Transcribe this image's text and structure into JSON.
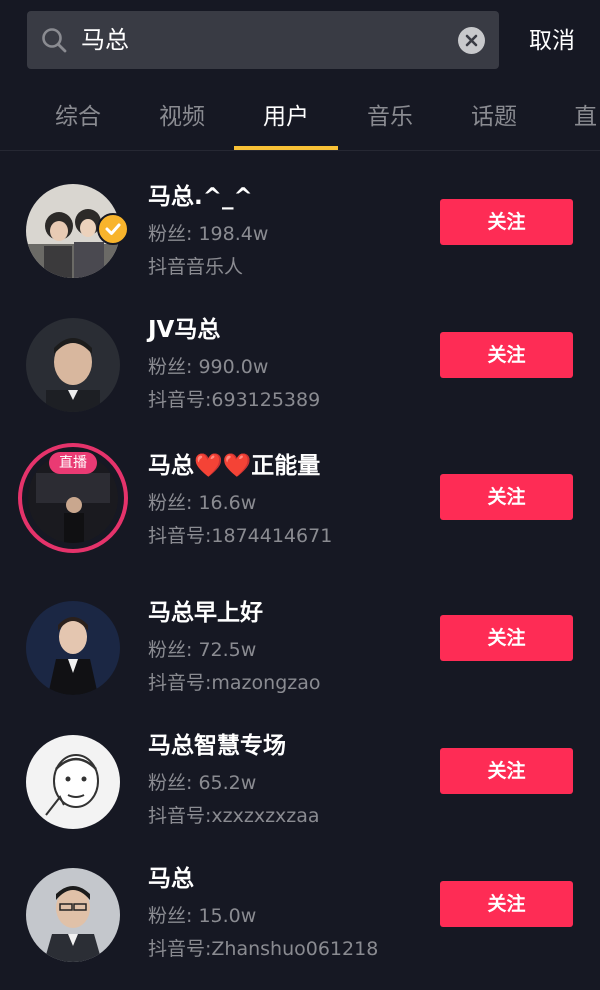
{
  "search": {
    "query": "马总",
    "cancel_label": "取消"
  },
  "tabs": [
    {
      "label": "综合"
    },
    {
      "label": "视频"
    },
    {
      "label": "用户"
    },
    {
      "label": "音乐"
    },
    {
      "label": "话题"
    },
    {
      "label": "直"
    }
  ],
  "active_tab": "用户",
  "users": [
    {
      "name": "马总.^_^",
      "fans": "粉丝: 198.4w",
      "sub": "抖音音乐人",
      "verified": true,
      "live": false,
      "live_label": "",
      "follow": "关注"
    },
    {
      "name": "JV马总",
      "fans": "粉丝: 990.0w",
      "sub": "抖音号:693125389",
      "verified": false,
      "live": false,
      "live_label": "",
      "follow": "关注"
    },
    {
      "name": "马总❤️❤️正能量",
      "fans": "粉丝: 16.6w",
      "sub": "抖音号:1874414671",
      "verified": false,
      "live": true,
      "live_label": "直播",
      "follow": "关注"
    },
    {
      "name": "马总早上好",
      "fans": "粉丝: 72.5w",
      "sub": "抖音号:mazongzao",
      "verified": false,
      "live": false,
      "live_label": "",
      "follow": "关注"
    },
    {
      "name": "马总智慧专场",
      "fans": "粉丝: 65.2w",
      "sub": "抖音号:xzxzxzxzaa",
      "verified": false,
      "live": false,
      "live_label": "",
      "follow": "关注"
    },
    {
      "name": "马总",
      "fans": "粉丝: 15.0w",
      "sub": "抖音号:Zhanshuo061218",
      "verified": false,
      "live": false,
      "live_label": "",
      "follow": "关注"
    }
  ],
  "colors": {
    "background": "#161823",
    "accent": "#fe2c55",
    "tab_indicator": "#f8c136",
    "verified_badge": "#f8b42c",
    "live_ring": "#e5336b"
  }
}
